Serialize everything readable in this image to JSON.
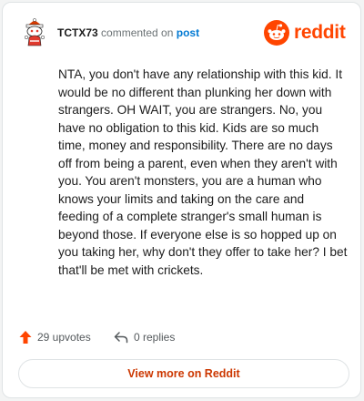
{
  "header": {
    "username": "TCTX73",
    "action_text": " commented on ",
    "target": "post",
    "avatar_icon": "snoo-avatar-icon",
    "brand_icon": "reddit-logo-icon",
    "brand_name": "reddit"
  },
  "comment": {
    "text": "NTA, you don't have any relationship with this kid. It would be no different than plunking her down with strangers. OH WAIT, you are strangers. No, you have no obligation to this kid. Kids are so much time, money and responsibility. There are no days off from being a parent, even when they aren't with you. You aren't monsters, you are a human who knows your limits and taking on the care and feeding of a complete stranger's small human is beyond those. If everyone else is so hopped up on you taking her, why don't they offer to take her? I bet that'll be met with crickets."
  },
  "actions": {
    "upvotes": "29 upvotes",
    "upvote_icon": "upvote-arrow-icon",
    "replies": "0 replies",
    "reply_icon": "reply-arrow-icon"
  },
  "cta": {
    "label": "View more on Reddit"
  },
  "colors": {
    "brand": "#ff4500",
    "link": "#0079d3",
    "cta_text": "#cc3700"
  }
}
